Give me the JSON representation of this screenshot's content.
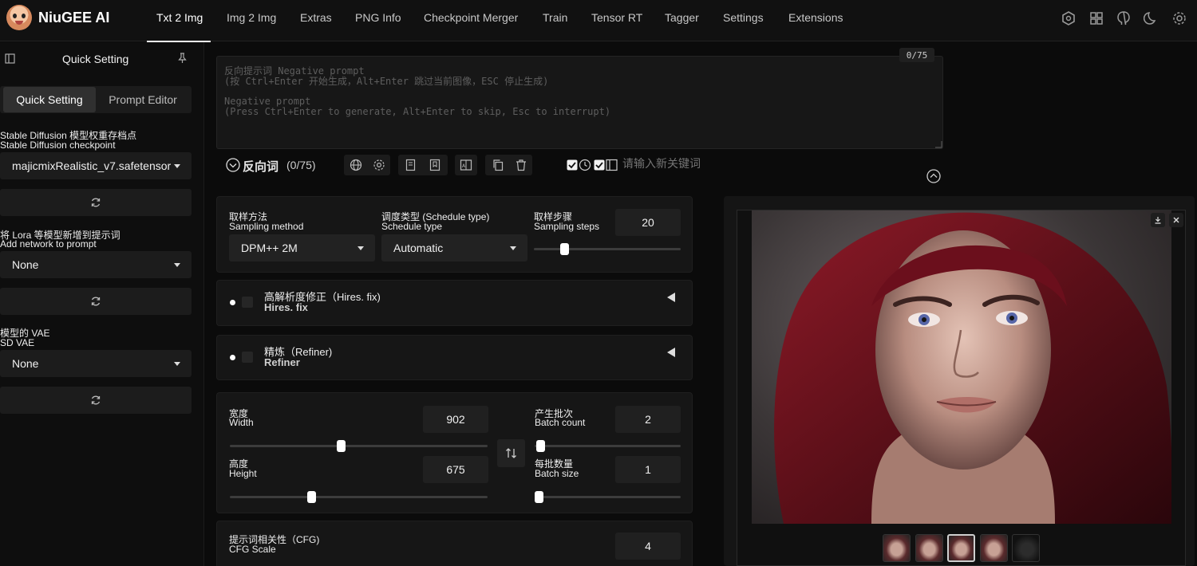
{
  "app": {
    "title": "NiuGEE AI"
  },
  "nav": {
    "tabs": [
      {
        "label": "Txt 2 Img"
      },
      {
        "label": "Img 2 Img"
      },
      {
        "label": "Extras"
      },
      {
        "label": "PNG Info"
      },
      {
        "label": "Checkpoint Merger"
      },
      {
        "label": "Train"
      },
      {
        "label": "Tensor RT"
      },
      {
        "label": "Tagger"
      },
      {
        "label": "Settings"
      },
      {
        "label": "Extensions"
      }
    ],
    "active_tab": "Txt 2 Img",
    "icons": [
      "hexagon-icon",
      "grid-icon",
      "github-icon",
      "moon-icon",
      "gear-icon"
    ]
  },
  "sidebar": {
    "title": "Quick Setting",
    "segments": [
      "Quick Setting",
      "Prompt Editor"
    ],
    "checkpoint": {
      "label_cn": "Stable Diffusion 模型权重存档点",
      "label_en": "Stable Diffusion checkpoint",
      "value": "majicmixRealistic_v7.safetensor"
    },
    "network": {
      "label_cn": "将 Lora 等模型新增到提示词",
      "label_en": "Add network to prompt",
      "value": "None"
    },
    "vae": {
      "label_cn": "模型的 VAE",
      "label_en": "SD VAE",
      "value": "None"
    }
  },
  "negative_prompt": {
    "token_count": "0/75",
    "placeholder_lines": [
      "反向提示词 Negative prompt",
      "(按 Ctrl+Enter 开始生成，Alt+Enter 跳过当前图像，ESC 停止生成)",
      "",
      "Negative prompt",
      "(Press Ctrl+Enter to generate, Alt+Enter to skip, Esc to interrupt)"
    ],
    "toolbar_label": "反向词",
    "toolbar_count": "(0/75)",
    "keyword_placeholder": "请输入新关键词"
  },
  "sampling": {
    "method": {
      "label_cn": "取样方法",
      "label_en": "Sampling method",
      "value": "DPM++ 2M"
    },
    "schedule": {
      "label_cn": "调度类型 (Schedule type)",
      "label_en": "Schedule type",
      "value": "Automatic"
    },
    "steps": {
      "label_cn": "取样步骤",
      "label_en": "Sampling steps",
      "value": "20",
      "fraction": 0.19
    }
  },
  "hires_fix": {
    "title_cn": "高解析度修正（Hires. fix)",
    "title_en": "Hires. fix"
  },
  "refiner": {
    "title_cn": "精炼（Refiner)",
    "title_en": "Refiner"
  },
  "dimensions": {
    "width": {
      "label_cn": "宽度",
      "label_en": "Width",
      "value": "902",
      "fraction": 0.43
    },
    "height": {
      "label_cn": "高度",
      "label_en": "Height",
      "value": "675",
      "fraction": 0.31
    },
    "batch_count": {
      "label_cn": "产生批次",
      "label_en": "Batch count",
      "value": "2",
      "fraction": 0.01
    },
    "batch_size": {
      "label_cn": "每批数量",
      "label_en": "Batch size",
      "value": "1",
      "fraction": 0.0
    }
  },
  "cfg": {
    "label_cn": "提示词相关性（CFG)",
    "label_en": "CFG Scale",
    "value": "4"
  },
  "gallery": {
    "thumbnail_count": 5,
    "selected_index": 2
  }
}
